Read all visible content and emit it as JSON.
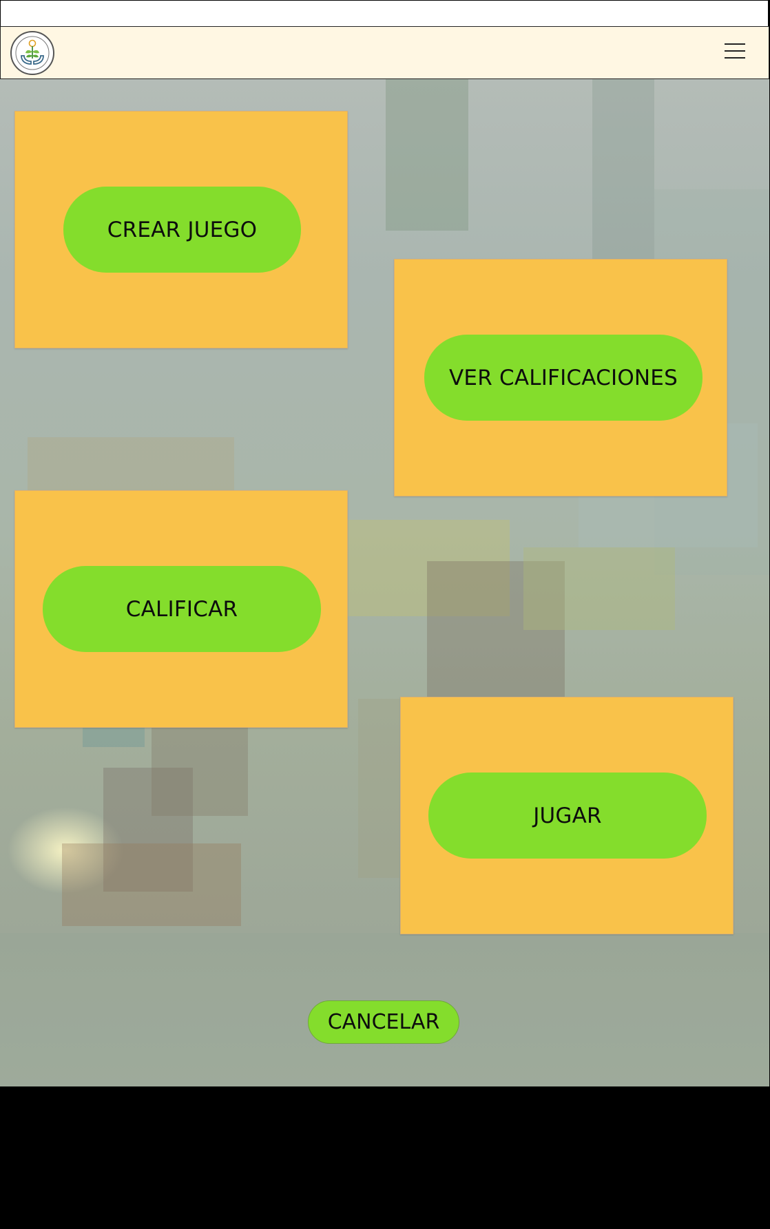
{
  "header": {
    "logo_icon": "hands-holding-plant-lightbulb-icon",
    "menu_icon": "hamburger-menu-icon"
  },
  "actions": {
    "crear_juego": "CREAR JUEGO",
    "ver_calificaciones": "VER CALIFICACIONES",
    "calificar": "CALIFICAR",
    "jugar": "JUGAR",
    "cancelar": "CANCELAR"
  },
  "colors": {
    "panel": "#f9c24a",
    "button": "#84dd2c",
    "navbar": "#fff7e3",
    "footer": "#000000"
  }
}
